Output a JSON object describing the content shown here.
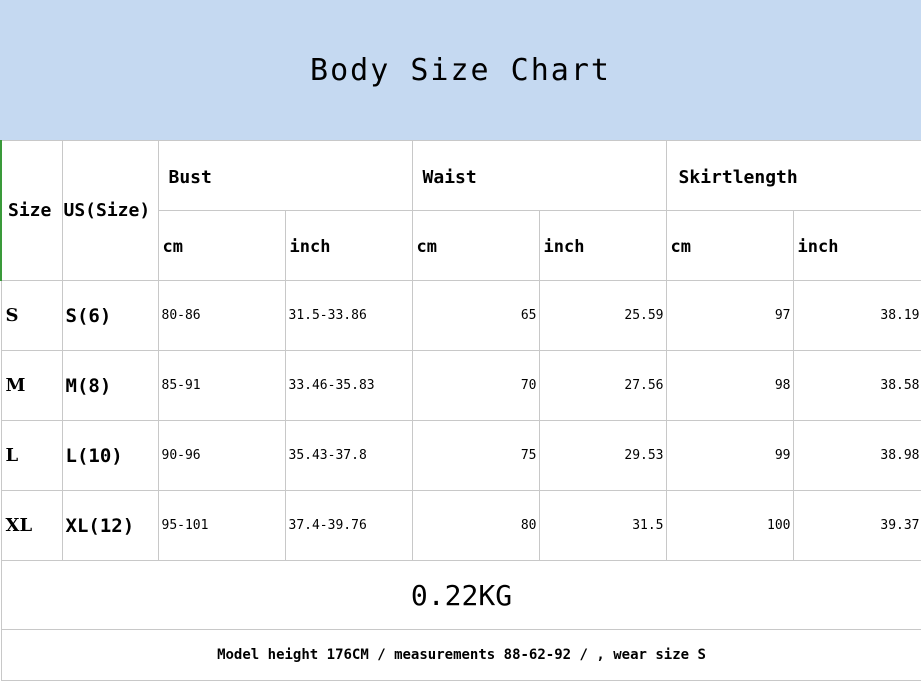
{
  "title": "Body Size Chart",
  "headers": {
    "size": "Size",
    "us_size": "US(Size)",
    "groups": [
      "Bust",
      "Waist",
      "Skirtlength"
    ],
    "units": [
      "cm",
      "inch",
      "cm",
      "inch",
      "cm",
      "inch"
    ]
  },
  "rows": [
    {
      "size": "S",
      "us": "S(6)",
      "bust_cm": "80-86",
      "bust_inch": "31.5-33.86",
      "waist_cm": "65",
      "waist_inch": "25.59",
      "skirt_cm": "97",
      "skirt_inch": "38.19"
    },
    {
      "size": "M",
      "us": "M(8)",
      "bust_cm": "85-91",
      "bust_inch": "33.46-35.83",
      "waist_cm": "70",
      "waist_inch": "27.56",
      "skirt_cm": "98",
      "skirt_inch": "38.58"
    },
    {
      "size": "L",
      "us": "L(10)",
      "bust_cm": "90-96",
      "bust_inch": "35.43-37.8",
      "waist_cm": "75",
      "waist_inch": "29.53",
      "skirt_cm": "99",
      "skirt_inch": "38.98"
    },
    {
      "size": "XL",
      "us": "XL(12)",
      "bust_cm": "95-101",
      "bust_inch": "37.4-39.76",
      "waist_cm": "80",
      "waist_inch": "31.5",
      "skirt_cm": "100",
      "skirt_inch": "39.37"
    }
  ],
  "weight": "0.22KG",
  "note": "Model height 176CM / measurements 88-62-92 / , wear size S",
  "colors": {
    "banner": "#c5d9f1"
  }
}
